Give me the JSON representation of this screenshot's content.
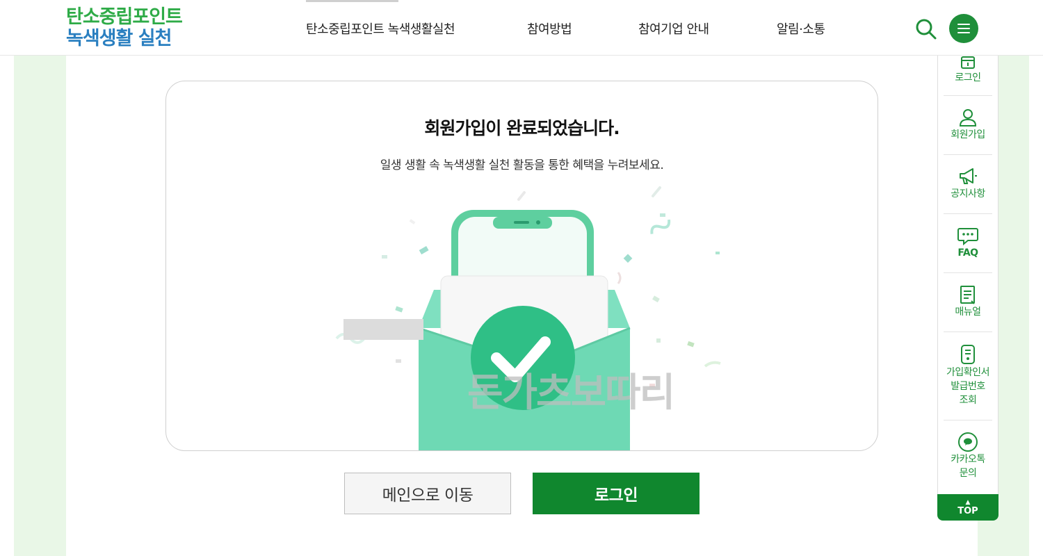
{
  "logo": {
    "line1": "탄소중립포인트",
    "line2": "녹색생활 실천"
  },
  "nav": {
    "items": [
      "탄소중립포인트 녹색생활실천",
      "참여방법",
      "참여기업 안내",
      "알림·소통"
    ]
  },
  "header": {
    "search_icon": "search-icon",
    "menu_icon": "hamburger-menu-icon"
  },
  "main": {
    "title": "회원가입이 완료되었습니다.",
    "subtitle": "일생 생활 속 녹색생활 실천 활동을 통한 혜택을 누려보세요.",
    "watermark": "돈가츠보따리"
  },
  "buttons": {
    "main_label": "메인으로 이동",
    "login_label": "로그인"
  },
  "quick_menu": {
    "items": [
      {
        "label": "로그인",
        "icon": "login-icon"
      },
      {
        "label": "회원가입",
        "icon": "user-icon"
      },
      {
        "label": "공지사항",
        "icon": "megaphone-icon"
      },
      {
        "label": "FAQ",
        "icon": "chat-icon"
      },
      {
        "label": "매뉴얼",
        "icon": "manual-icon"
      },
      {
        "label": "가입확인서\n발급번호\n조회",
        "icon": "document-icon"
      },
      {
        "label": "카카오톡\n문의",
        "icon": "kakaotalk-icon"
      }
    ],
    "top_label": "TOP"
  },
  "colors": {
    "brand_green": "#10872e",
    "logo_green": "#2eab47",
    "logo_blue": "#2a7fc0",
    "strip": "#e9f7e7"
  }
}
